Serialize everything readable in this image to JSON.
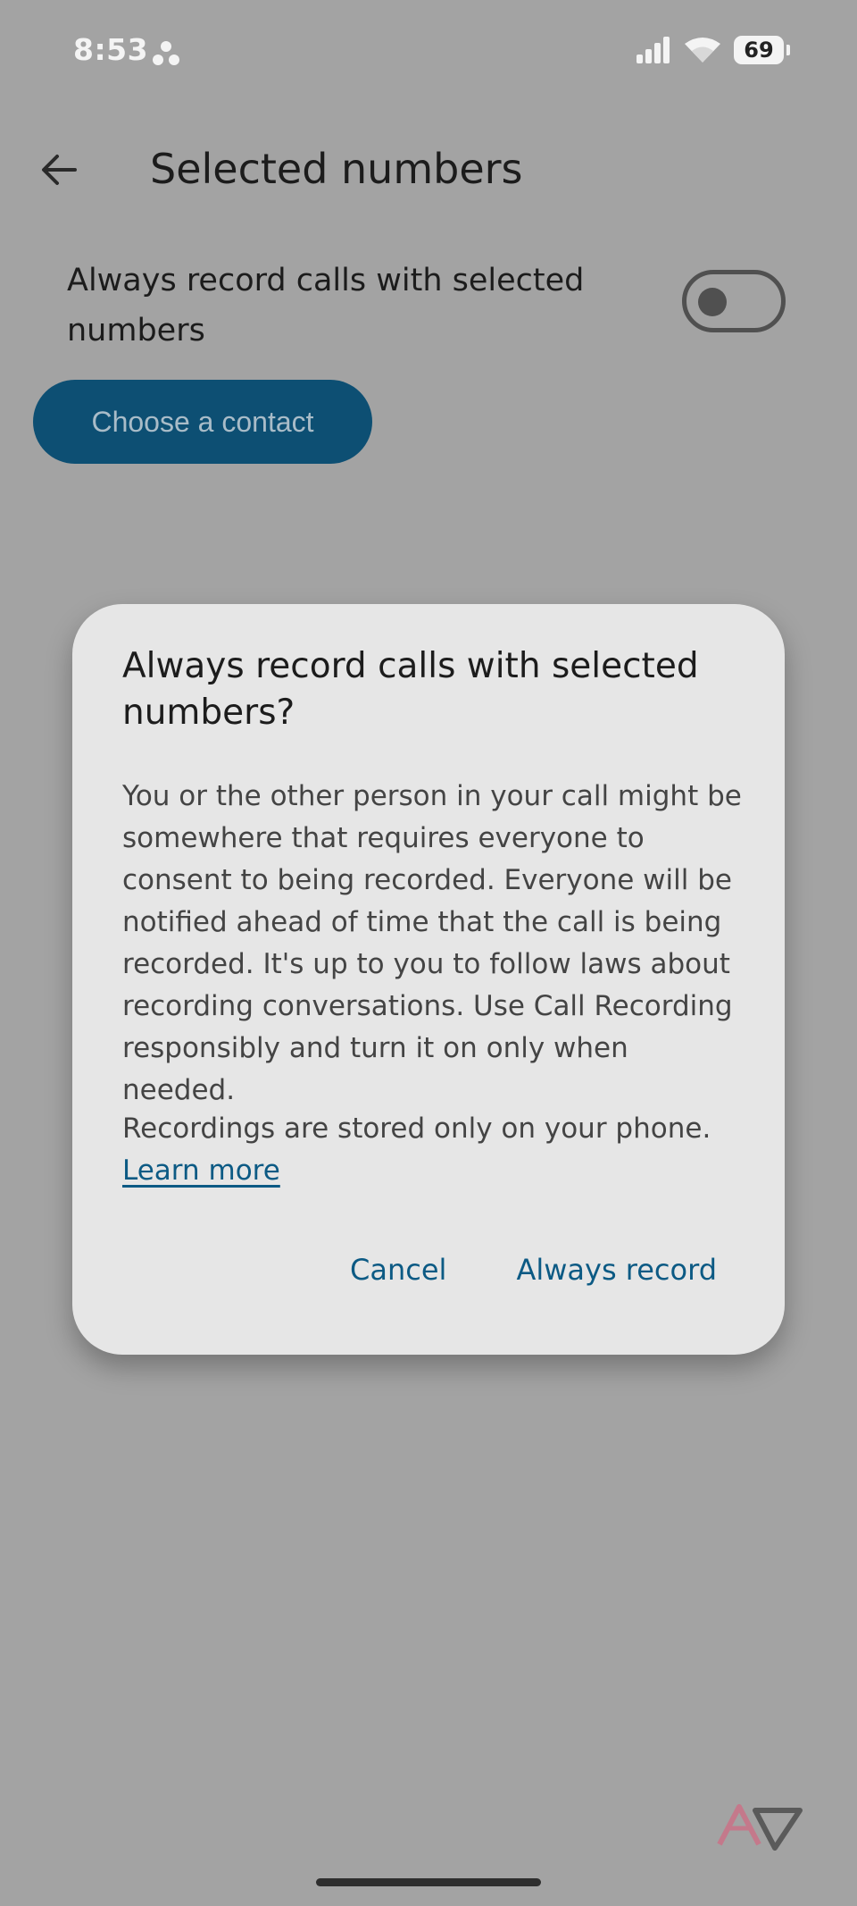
{
  "status_bar": {
    "time": "8:53",
    "battery_level": "69"
  },
  "header": {
    "title": "Selected numbers"
  },
  "setting": {
    "label": "Always record calls with selected numbers",
    "toggle_on": false
  },
  "choose_contact": {
    "label": "Choose a contact"
  },
  "dialog": {
    "title": "Always record calls with selected numbers?",
    "body": "You or the other person in your call might be somewhere that requires everyone to consent to being recorded. Everyone will be notified ahead of time that the call is being recorded. It's up to you to follow laws about recording conversations. Use Call Recording responsibly and turn it on only when needed.",
    "storage_note": "Recordings are stored only on your phone.",
    "learn_more": "Learn more",
    "cancel_label": "Cancel",
    "confirm_label": "Always record"
  },
  "colors": {
    "scrim_background": "#a3a3a3",
    "dialog_background": "#e6e6e6",
    "accent": "#0c5a84",
    "contact_button": "#0d4f73"
  },
  "icons": {
    "back": "arrow-back-icon",
    "status_notification": "dots-icon",
    "signal": "signal-icon",
    "wifi": "wifi-icon",
    "battery": "battery-icon",
    "watermark": "logo-icon"
  }
}
